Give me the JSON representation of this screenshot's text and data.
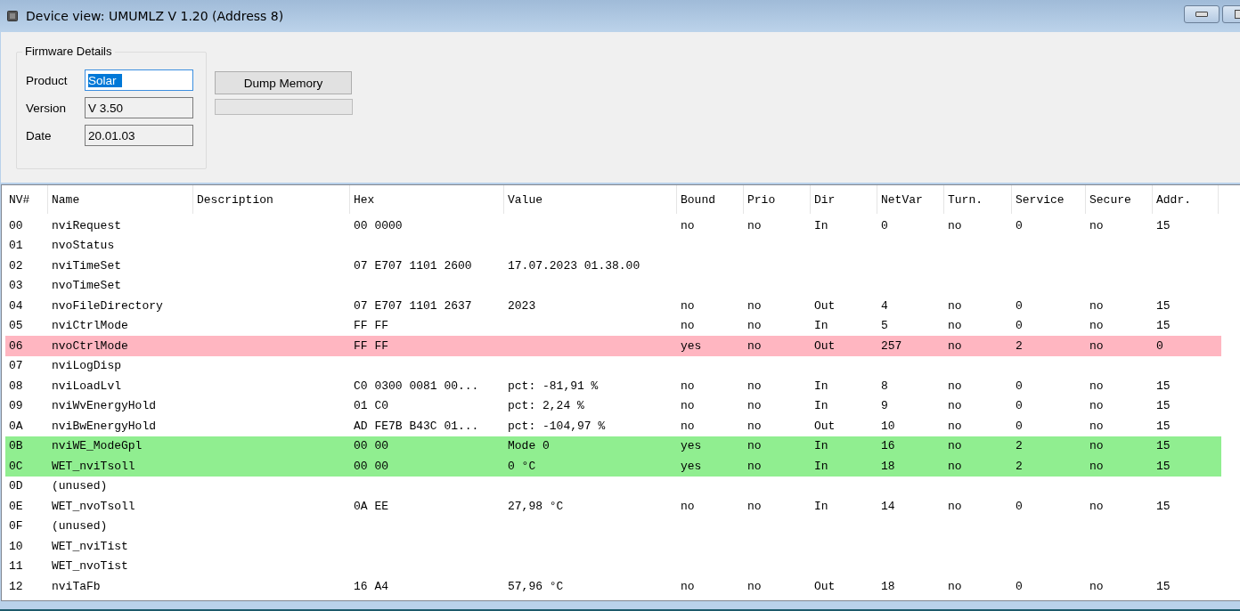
{
  "window": {
    "title": "Device view: UMUMLZ V 1.20 (Address 8)"
  },
  "firmware": {
    "title": "Firmware Details",
    "fields": [
      {
        "label": "Product",
        "value": "Solar",
        "focused": true
      },
      {
        "label": "Version",
        "value": "V 3.50",
        "focused": false
      },
      {
        "label": "Date",
        "value": "20.01.03",
        "focused": false
      }
    ]
  },
  "dump_button": "Dump Memory",
  "progress": {
    "level": 0
  },
  "table": {
    "columns": [
      "NV#",
      "Name",
      "Description",
      "Hex",
      "Value",
      "Bound",
      "Prio",
      "Dir",
      "NetVar",
      "Turn.",
      "Service",
      "Secure",
      "Addr."
    ],
    "rows": [
      {
        "nv": "00",
        "name": "nviRequest",
        "hex": "00 0000",
        "bound": "no",
        "prio": "no",
        "dir": "In",
        "netvar": "0",
        "turn": "no",
        "service": "0",
        "secure": "no",
        "addr": "15"
      },
      {
        "nv": "01",
        "name": "nvoStatus"
      },
      {
        "nv": "02",
        "name": "nviTimeSet",
        "hex": "07 E707 1101 2600",
        "value": "17.07.2023 01.38.00"
      },
      {
        "nv": "03",
        "name": "nvoTimeSet"
      },
      {
        "nv": "04",
        "name": "nvoFileDirectory",
        "hex": "07 E707 1101 2637",
        "value": "2023",
        "bound": "no",
        "prio": "no",
        "dir": "Out",
        "netvar": "4",
        "turn": "no",
        "service": "0",
        "secure": "no",
        "addr": "15"
      },
      {
        "nv": "05",
        "name": "nviCtrlMode",
        "hex": "FF FF",
        "bound": "no",
        "prio": "no",
        "dir": "In",
        "netvar": "5",
        "turn": "no",
        "service": "0",
        "secure": "no",
        "addr": "15"
      },
      {
        "nv": "06",
        "name": "nvoCtrlMode",
        "hex": "FF FF",
        "bound": "yes",
        "prio": "no",
        "dir": "Out",
        "netvar": "257",
        "turn": "no",
        "service": "2",
        "secure": "no",
        "addr": "0",
        "color": "#ffb6c1"
      },
      {
        "nv": "07",
        "name": "nviLogDisp"
      },
      {
        "nv": "08",
        "name": "nviLoadLvl",
        "hex": "C0 0300 0081 00...",
        "value": "pct: -81,91 %",
        "bound": "no",
        "prio": "no",
        "dir": "In",
        "netvar": "8",
        "turn": "no",
        "service": "0",
        "secure": "no",
        "addr": "15"
      },
      {
        "nv": "09",
        "name": "nviWvEnergyHold",
        "hex": "01 C0",
        "value": "pct: 2,24 %",
        "bound": "no",
        "prio": "no",
        "dir": "In",
        "netvar": "9",
        "turn": "no",
        "service": "0",
        "secure": "no",
        "addr": "15"
      },
      {
        "nv": "0A",
        "name": "nviBwEnergyHold",
        "hex": "AD FE7B B43C 01...",
        "value": "pct: -104,97 %",
        "bound": "no",
        "prio": "no",
        "dir": "Out",
        "netvar": "10",
        "turn": "no",
        "service": "0",
        "secure": "no",
        "addr": "15"
      },
      {
        "nv": "0B",
        "name": "nviWE_ModeGpl",
        "hex": "00 00",
        "value": "Mode 0",
        "bound": "yes",
        "prio": "no",
        "dir": "In",
        "netvar": "16",
        "turn": "no",
        "service": "2",
        "secure": "no",
        "addr": "15",
        "color": "#90ee90"
      },
      {
        "nv": "0C",
        "name": "WET_nviTsoll",
        "hex": "00 00",
        "value": "0 °C",
        "bound": "yes",
        "prio": "no",
        "dir": "In",
        "netvar": "18",
        "turn": "no",
        "service": "2",
        "secure": "no",
        "addr": "15",
        "color": "#90ee90"
      },
      {
        "nv": "0D",
        "name": "(unused)"
      },
      {
        "nv": "0E",
        "name": "WET_nvoTsoll",
        "hex": "0A EE",
        "value": "27,98 °C",
        "bound": "no",
        "prio": "no",
        "dir": "In",
        "netvar": "14",
        "turn": "no",
        "service": "0",
        "secure": "no",
        "addr": "15"
      },
      {
        "nv": "0F",
        "name": "(unused)"
      },
      {
        "nv": "10",
        "name": "WET_nviTist"
      },
      {
        "nv": "11",
        "name": "WET_nvoTist"
      },
      {
        "nv": "12",
        "name": "nviTaFb",
        "hex": "16 A4",
        "value": "57,96 °C",
        "bound": "no",
        "prio": "no",
        "dir": "Out",
        "netvar": "18",
        "turn": "no",
        "service": "0",
        "secure": "no",
        "addr": "15"
      }
    ]
  }
}
